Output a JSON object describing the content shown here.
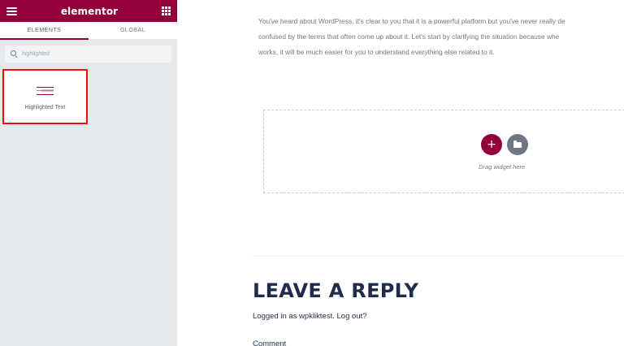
{
  "sidebar": {
    "brand": "elementor",
    "tabs": [
      {
        "label": "ELEMENTS",
        "active": true
      },
      {
        "label": "GLOBAL",
        "active": false
      }
    ],
    "search": {
      "value": "highlighted",
      "placeholder": "Search Widget..."
    },
    "widgets": [
      {
        "label": "Highlighted Text",
        "icon": "highlighted-text-icon",
        "selected": true
      }
    ],
    "collapse_glyph": "‹"
  },
  "main": {
    "intro_lines": [
      "You've heard about WordPress, it's clear to you that it is a powerful platform but you've never really de",
      "confused by the terms that often come up about it. Let's start by clarifying the situation because whe",
      "works, it will be much easier for you to understand everything else related to it."
    ],
    "dropzone": {
      "add_glyph": "+",
      "text": "Drag widget here"
    },
    "reply": {
      "title": "LEAVE A REPLY",
      "logged_in_prefix": "Logged in as wpkliktest.",
      "logout_label": "Log out?",
      "comment_label": "Comment"
    }
  },
  "colors": {
    "brand": "#93003c",
    "highlight_border": "#e3120b",
    "heading": "#1e2b4a",
    "panel_bg": "#e6e9ec"
  }
}
